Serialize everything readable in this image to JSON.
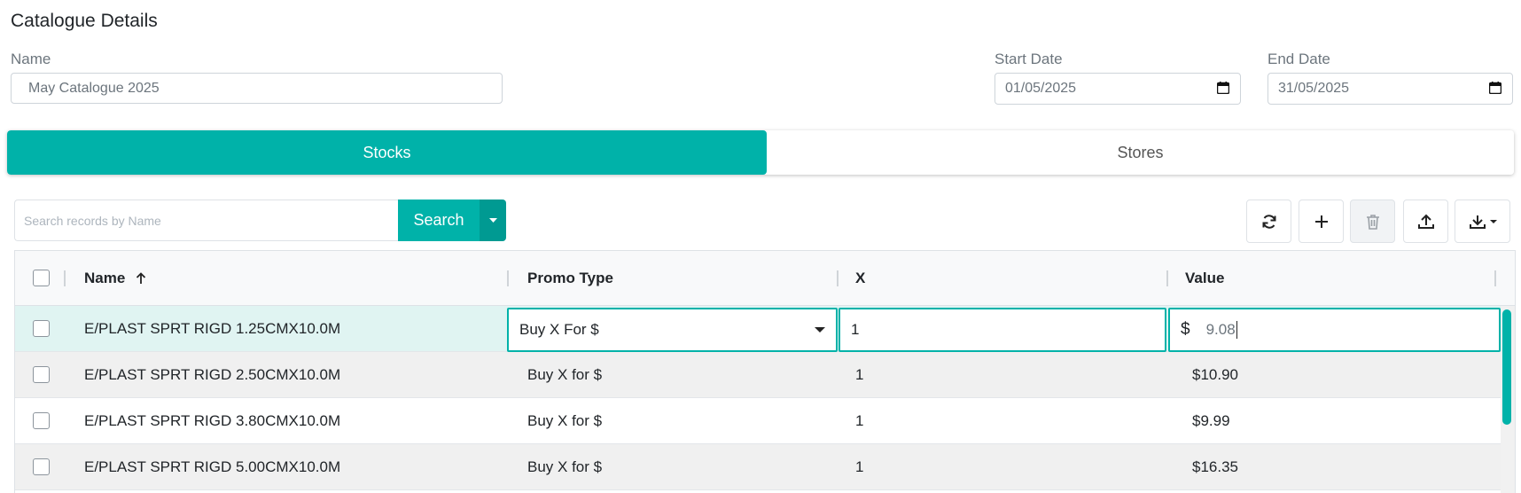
{
  "header": {
    "title": "Catalogue Details"
  },
  "form": {
    "name_label": "Name",
    "name_value": "May Catalogue 2025",
    "start_label": "Start Date",
    "start_value": "01/05/2025",
    "end_label": "End Date",
    "end_value": "31/05/2025"
  },
  "tabs": [
    {
      "label": "Stocks",
      "active": true
    },
    {
      "label": "Stores",
      "active": false
    }
  ],
  "search": {
    "placeholder": "Search records by Name",
    "button_label": "Search"
  },
  "toolbar": {
    "icons": [
      "refresh-icon",
      "plus-icon",
      "trash-icon",
      "upload-icon",
      "download-icon"
    ]
  },
  "table": {
    "columns": {
      "name": "Name",
      "promo_type": "Promo Type",
      "x": "X",
      "value": "Value"
    },
    "sort_icon": "arrow-up-icon",
    "editing_row": {
      "name": "E/PLAST SPRT RIGD 1.25CMX10.0M",
      "promo_type": "Buy X For $",
      "x": "1",
      "currency": "$",
      "value": "9.08"
    },
    "rows": [
      {
        "name": "E/PLAST SPRT RIGD 2.50CMX10.0M",
        "promo_type": "Buy X for $",
        "x": "1",
        "value": "$10.90"
      },
      {
        "name": "E/PLAST SPRT RIGD 3.80CMX10.0M",
        "promo_type": "Buy X for $",
        "x": "1",
        "value": "$9.99"
      },
      {
        "name": "E/PLAST SPRT RIGD 5.00CMX10.0M",
        "promo_type": "Buy X for $",
        "x": "1",
        "value": "$16.35"
      }
    ]
  },
  "colors": {
    "accent": "#00b2a9",
    "accent_dark": "#009a92",
    "selected_row": "#e0f4f2",
    "striped_row": "#f0f0f0"
  }
}
